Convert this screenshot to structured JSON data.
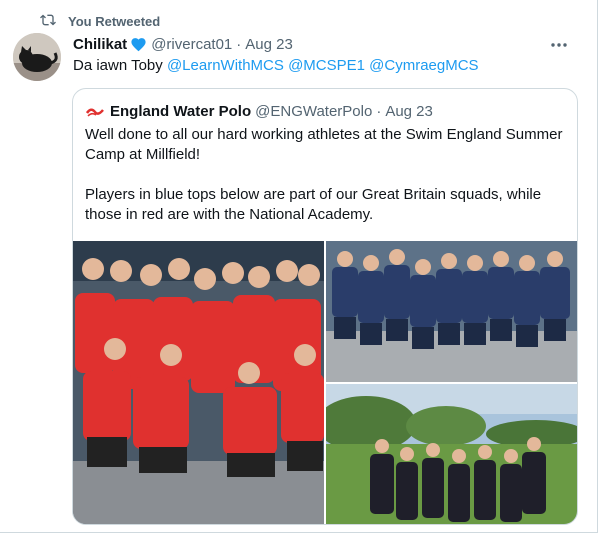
{
  "retweet": {
    "label": "You Retweeted",
    "icon": "retweet-icon"
  },
  "tweet": {
    "author_name": "Chilikat",
    "verified_icon": "blue-heart-icon",
    "handle": "@rivercat01",
    "separator": "·",
    "date": "Aug 23",
    "more_icon": "more-icon",
    "text_prefix": "Da iawn Toby",
    "mentions": [
      "@LearnWithMCS",
      "@MCSPE1",
      "@CymraegMCS"
    ]
  },
  "quoted": {
    "author_name": "England Water Polo",
    "handle": "@ENGWaterPolo",
    "separator": "·",
    "date": "Aug 23",
    "paragraphs": [
      "Well done to all our hard working athletes at the Swim England Summer Camp at Millfield!",
      "Players in blue tops below are part of our Great Britain squads, while those in red are with the National Academy."
    ]
  },
  "colors": {
    "link": "#1d9bf0",
    "muted": "#536471",
    "border": "#cfd9de",
    "red_tops": "#e0312f",
    "navy_tops": "#2a3d6a"
  }
}
